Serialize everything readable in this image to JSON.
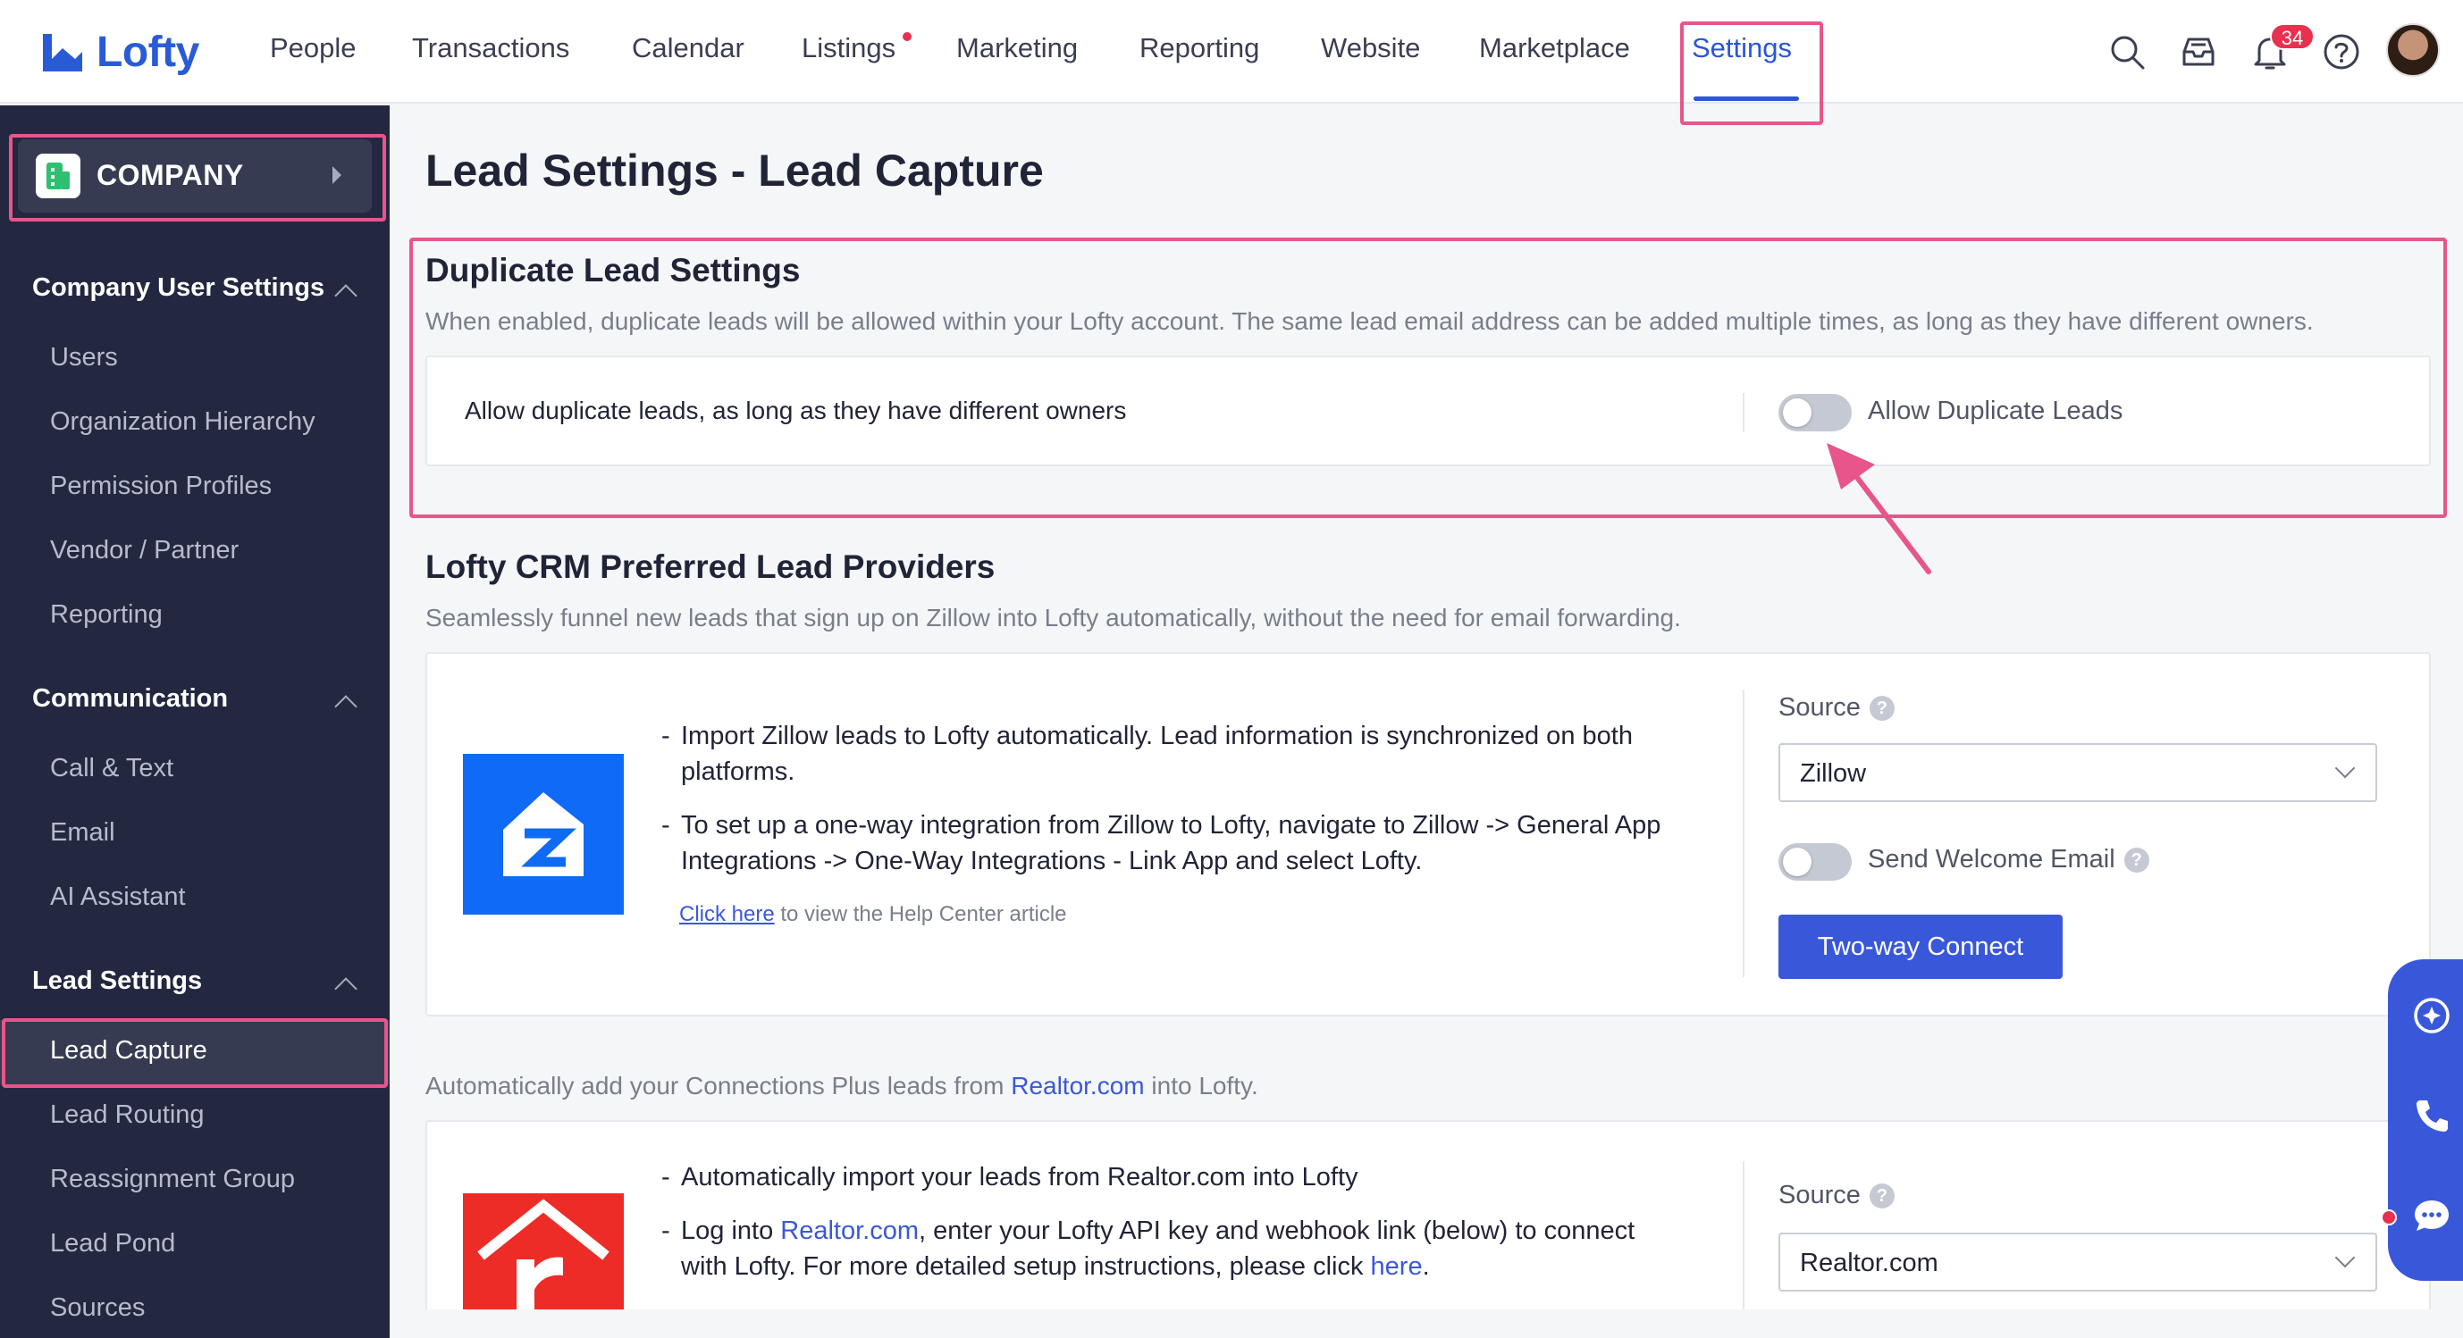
{
  "app": {
    "name": "Lofty",
    "brand_color": "#2a5bd7",
    "accent_color": "#3958d9",
    "highlight_color": "#e8558a"
  },
  "topnav": {
    "items": [
      "People",
      "Transactions",
      "Calendar",
      "Listings",
      "Marketing",
      "Reporting",
      "Website",
      "Marketplace",
      "Settings"
    ],
    "active": "Settings",
    "notification_count": "34",
    "icons": [
      "search-icon",
      "inbox-icon",
      "bell-icon",
      "help-icon",
      "avatar"
    ]
  },
  "sidebar": {
    "company_label": "COMPANY",
    "sections": [
      {
        "title": "Company User Settings",
        "items": [
          "Users",
          "Organization Hierarchy",
          "Permission Profiles",
          "Vendor / Partner",
          "Reporting"
        ]
      },
      {
        "title": "Communication",
        "items": [
          "Call & Text",
          "Email",
          "AI Assistant"
        ]
      },
      {
        "title": "Lead Settings",
        "items": [
          "Lead Capture",
          "Lead Routing",
          "Reassignment Group",
          "Lead Pond",
          "Sources"
        ]
      }
    ],
    "active_item": "Lead Capture"
  },
  "main": {
    "page_title": "Lead Settings - Lead Capture",
    "duplicate": {
      "title": "Duplicate Lead Settings",
      "description": "When enabled, duplicate leads will be allowed within your Lofty account. The same lead email address can be added multiple times, as long as they have different owners.",
      "row_label": "Allow duplicate leads, as long as they have different owners",
      "toggle_label": "Allow Duplicate Leads",
      "toggle_on": false
    },
    "providers": {
      "title": "Lofty CRM Preferred Lead Providers",
      "description": "Seamlessly funnel new leads that sign up on Zillow into Lofty automatically, without the need for email forwarding.",
      "zillow": {
        "bullet1": "Import Zillow leads to Lofty automatically. Lead information is synchronized on both platforms.",
        "bullet2": "To set up a one-way integration from Zillow to Lofty, navigate to Zillow -> General App Integrations -> One-Way Integrations - Link App and select Lofty.",
        "help_link": "Click here",
        "help_suffix": "to view the Help Center article",
        "source_label": "Source",
        "source_value": "Zillow",
        "welcome_label": "Send Welcome Email",
        "welcome_on": false,
        "connect_button": "Two-way Connect"
      },
      "realtor": {
        "intro_prefix": "Automatically add your Connections Plus leads from",
        "intro_link": "Realtor.com",
        "intro_suffix": "into Lofty.",
        "bullet1": "Automatically import your leads from Realtor.com into Lofty",
        "bullet2_prefix": "Log into",
        "bullet2_link": "Realtor.com",
        "bullet2_mid": ", enter your Lofty API key and webhook link (below) to connect",
        "bullet2_line2": "with Lofty. For more detailed setup instructions, please click",
        "bullet2_link2": "here",
        "bullet2_end": ".",
        "source_label": "Source",
        "source_value": "Realtor.com"
      }
    }
  }
}
